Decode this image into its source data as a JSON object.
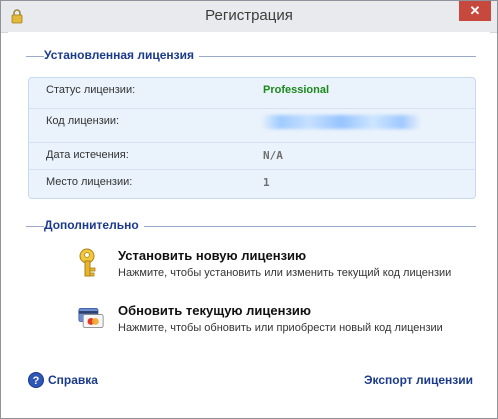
{
  "window": {
    "title": "Регистрация",
    "close_label": "✕"
  },
  "installed": {
    "header": "Установленная лицензия",
    "rows": [
      {
        "label": "Статус лицензии:",
        "value": "Professional"
      },
      {
        "label": "Код лицензии:",
        "value": ""
      },
      {
        "label": "Дата истечения:",
        "value": "N/A"
      },
      {
        "label": "Место лицензии:",
        "value": "1"
      }
    ]
  },
  "additional": {
    "header": "Дополнительно",
    "install": {
      "title": "Установить новую лицензию",
      "desc": "Нажмите, чтобы установить или изменить текущий код лицензии",
      "icon": "key-icon"
    },
    "renew": {
      "title": "Обновить текущую лицензию",
      "desc": "Нажмите, чтобы обновить или приобрести новый код лицензии",
      "icon": "credit-card-icon"
    }
  },
  "footer": {
    "help_label": "Справка",
    "export_label": "Экспорт лицензии"
  },
  "colors": {
    "accent": "#1b3a8a",
    "status_green": "#1a8a1a",
    "close_red": "#c7483c",
    "panel_bg": "#eaf2fb"
  }
}
